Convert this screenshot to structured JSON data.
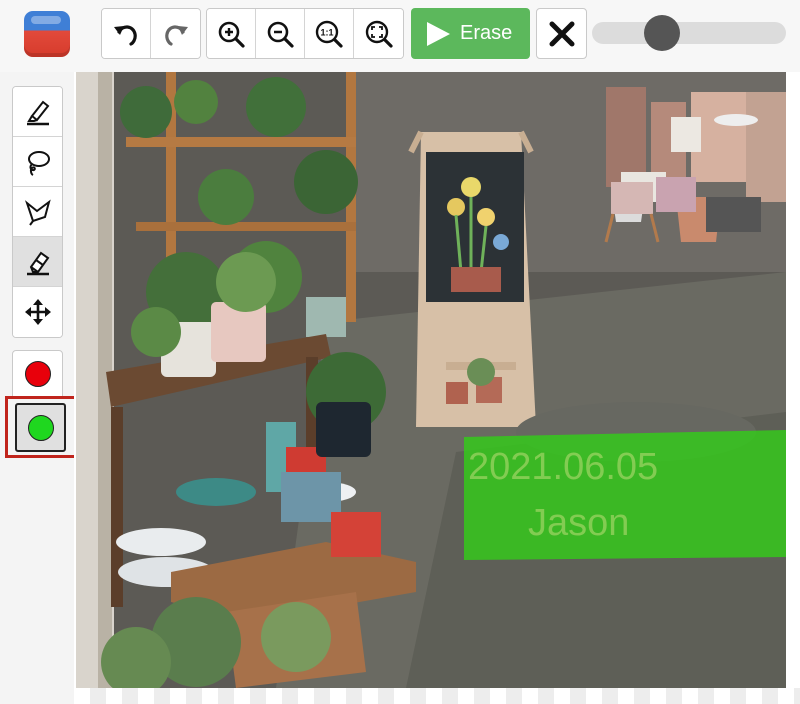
{
  "toolbar": {
    "undo_icon": "undo-icon",
    "redo_icon": "redo-icon",
    "zoom_in_icon": "zoom-in-icon",
    "zoom_out_icon": "zoom-out-icon",
    "actual_size_label": "1:1",
    "fit_icon": "fit-screen-icon",
    "erase_label": "Erase",
    "close_icon": "close-icon",
    "brush_size_level": 0.33
  },
  "tools": [
    {
      "name": "highlighter",
      "icon": "highlighter-icon",
      "active": false
    },
    {
      "name": "lasso",
      "icon": "lasso-icon",
      "active": false
    },
    {
      "name": "polygon-lasso",
      "icon": "polygon-lasso-icon",
      "active": false
    },
    {
      "name": "eraser",
      "icon": "eraser-icon",
      "active": true
    },
    {
      "name": "move",
      "icon": "move-icon",
      "active": false
    }
  ],
  "colors": {
    "red": "#e8000b",
    "green": "#1fd71f",
    "selected": "green",
    "selection_border": "#c0241c",
    "erase_button": "#5cb85c",
    "mask_overlay": "#33cc1a"
  },
  "canvas": {
    "watermark_line1": "2021.06.05",
    "watermark_line2": "Jason"
  }
}
